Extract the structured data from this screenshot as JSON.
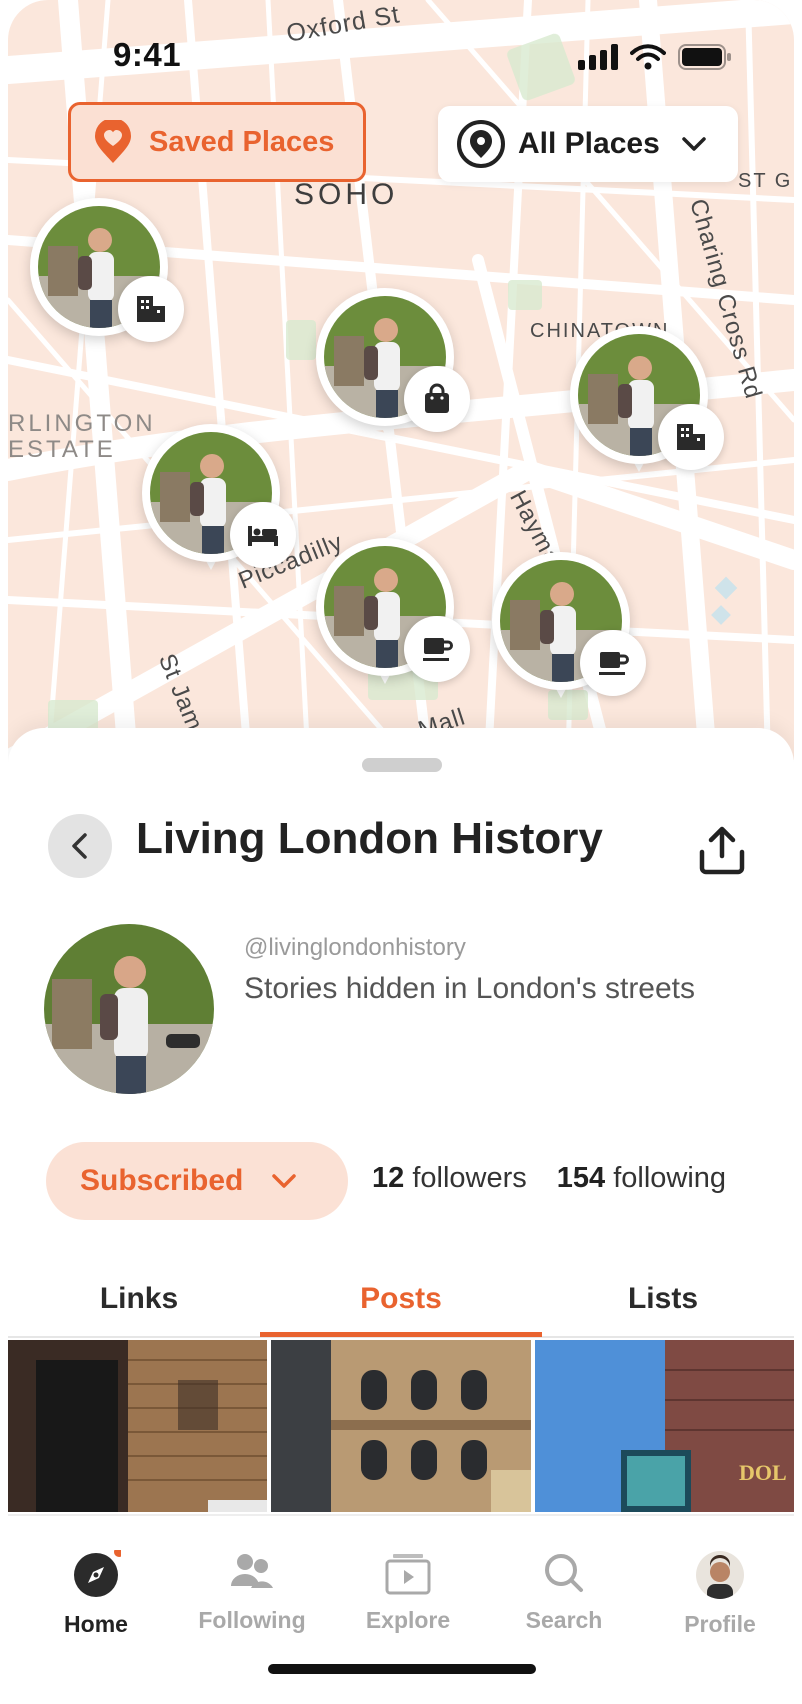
{
  "status_bar": {
    "time": "9:41"
  },
  "map": {
    "streets": [
      "Oxford St",
      "Charing Cross Rd",
      "Piccadilly",
      "Haymarket",
      "St James",
      "Mall"
    ],
    "areas": [
      "SOHO",
      "CHINATOWN",
      "RLINGTON",
      "ESTATE",
      "ST GI"
    ],
    "saved_places_label": "Saved Places",
    "filter_label": "All Places",
    "pins": [
      {
        "badge": "building-icon"
      },
      {
        "badge": "shopping-bag-icon"
      },
      {
        "badge": "building-icon"
      },
      {
        "badge": "bed-icon"
      },
      {
        "badge": "coffee-icon"
      },
      {
        "badge": "coffee-icon"
      }
    ]
  },
  "profile": {
    "title": "Living London History",
    "handle": "@livinglondonhistory",
    "bio": "Stories hidden in London's streets",
    "subscribe_label": "Subscribed",
    "followers_count": "12",
    "followers_label": "followers",
    "following_count": "154",
    "following_label": "following"
  },
  "tabs": [
    {
      "label": "Links"
    },
    {
      "label": "Posts"
    },
    {
      "label": "Lists"
    }
  ],
  "nav": {
    "home": "Home",
    "following": "Following",
    "explore": "Explore",
    "search": "Search",
    "profile": "Profile"
  },
  "colors": {
    "accent": "#e9632f",
    "accent_light": "#fbe1d5",
    "map_bg": "#fbe7dc"
  }
}
